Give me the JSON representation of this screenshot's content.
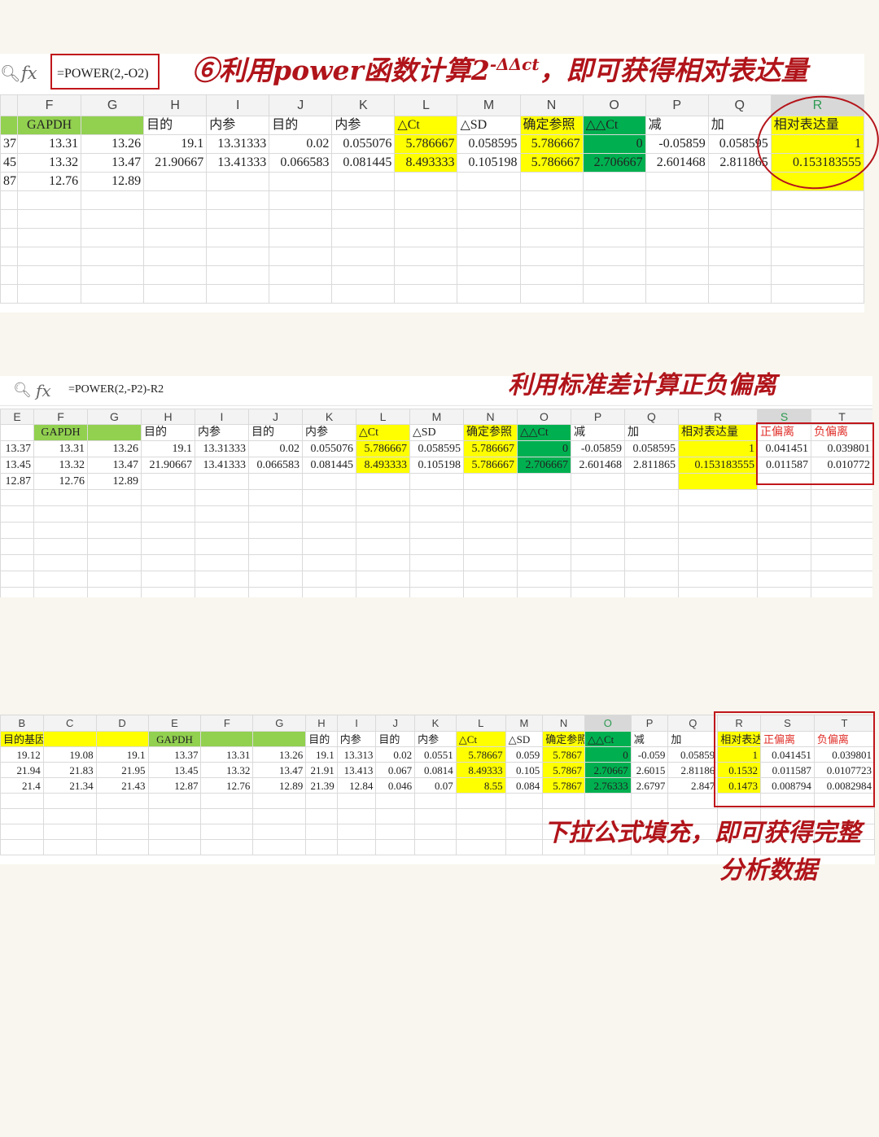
{
  "colors": {
    "yellow": "#ffff00",
    "green": "#00b050",
    "light_green": "#92d050",
    "annotation_red": "#b0141a"
  },
  "annotations": {
    "step6": "⑥利用power函数计算2",
    "step6_sup": "-ΔΔct",
    "step6_tail": "，即可获得相对表达量",
    "std": "利用标准差计算正负偏离",
    "fill_line1": "下拉公式填充，即可获得完整",
    "fill_line2": "分析数据"
  },
  "panel1": {
    "formula": "=POWER(2,-O2)",
    "columns": [
      "F",
      "G",
      "H",
      "I",
      "J",
      "K",
      "L",
      "M",
      "N",
      "O",
      "P",
      "Q",
      "R"
    ],
    "header_row": [
      "GAPDH",
      "",
      "目的",
      "内参",
      "目的",
      "内参",
      "△Ct",
      "△SD",
      "确定参照",
      "△△Ct",
      "减",
      "加",
      "相对表达量"
    ],
    "rows": [
      [
        "37",
        "13.31",
        "13.26",
        "19.1",
        "13.31333",
        "0.02",
        "0.055076",
        "5.786667",
        "0.058595",
        "5.786667",
        "0",
        "-0.05859",
        "0.058595",
        "1"
      ],
      [
        "45",
        "13.32",
        "13.47",
        "21.90667",
        "13.41333",
        "0.066583",
        "0.081445",
        "8.493333",
        "0.105198",
        "5.786667",
        "2.706667",
        "2.601468",
        "2.811865",
        "0.153183555"
      ],
      [
        "87",
        "12.76",
        "12.89",
        "",
        "",
        "",
        "",
        "",
        "",
        "",
        "",
        "",
        "",
        ""
      ]
    ]
  },
  "panel2": {
    "formula": "=POWER(2,-P2)-R2",
    "columns": [
      "E",
      "F",
      "G",
      "H",
      "I",
      "J",
      "K",
      "L",
      "M",
      "N",
      "O",
      "P",
      "Q",
      "R",
      "S",
      "T"
    ],
    "header_row": [
      "",
      "GAPDH",
      "",
      "目的",
      "内参",
      "目的",
      "内参",
      "△Ct",
      "△SD",
      "确定参照",
      "△△Ct",
      "减",
      "加",
      "相对表达量",
      "正偏离",
      "负偏离"
    ],
    "rows": [
      [
        "13.37",
        "13.31",
        "13.26",
        "19.1",
        "13.31333",
        "0.02",
        "0.055076",
        "5.786667",
        "0.058595",
        "5.786667",
        "0",
        "-0.05859",
        "0.058595",
        "1",
        "0.041451",
        "0.039801"
      ],
      [
        "13.45",
        "13.32",
        "13.47",
        "21.90667",
        "13.41333",
        "0.066583",
        "0.081445",
        "8.493333",
        "0.105198",
        "5.786667",
        "2.706667",
        "2.601468",
        "2.811865",
        "0.153183555",
        "0.011587",
        "0.010772"
      ],
      [
        "12.87",
        "12.76",
        "12.89",
        "",
        "",
        "",
        "",
        "",
        "",
        "",
        "",
        "",
        "",
        "",
        "",
        ""
      ]
    ]
  },
  "panel3": {
    "columns": [
      "B",
      "C",
      "D",
      "E",
      "F",
      "G",
      "H",
      "I",
      "J",
      "K",
      "L",
      "M",
      "N",
      "O",
      "P",
      "Q",
      "R",
      "S",
      "T"
    ],
    "header_row": [
      "目的基因",
      "",
      "",
      "GAPDH",
      "",
      "",
      "目的",
      "内参",
      "目的",
      "内参",
      "△Ct",
      "△SD",
      "确定参照",
      "△△Ct",
      "减",
      "加",
      "相对表达量",
      "正偏离",
      "负偏离"
    ],
    "rows": [
      [
        "19.12",
        "19.08",
        "19.1",
        "13.37",
        "13.31",
        "13.26",
        "19.1",
        "13.313",
        "0.02",
        "0.0551",
        "5.78667",
        "0.059",
        "5.7867",
        "0",
        "-0.059",
        "0.05859",
        "1",
        "0.041451",
        "0.039801"
      ],
      [
        "21.94",
        "21.83",
        "21.95",
        "13.45",
        "13.32",
        "13.47",
        "21.91",
        "13.413",
        "0.067",
        "0.0814",
        "8.49333",
        "0.105",
        "5.7867",
        "2.70667",
        "2.6015",
        "2.81186",
        "0.1532",
        "0.011587",
        "0.0107723"
      ],
      [
        "21.4",
        "21.34",
        "21.43",
        "12.87",
        "12.76",
        "12.89",
        "21.39",
        "12.84",
        "0.046",
        "0.07",
        "8.55",
        "0.084",
        "5.7867",
        "2.76333",
        "2.6797",
        "2.847",
        "0.1473",
        "0.008794",
        "0.0082984"
      ]
    ]
  }
}
